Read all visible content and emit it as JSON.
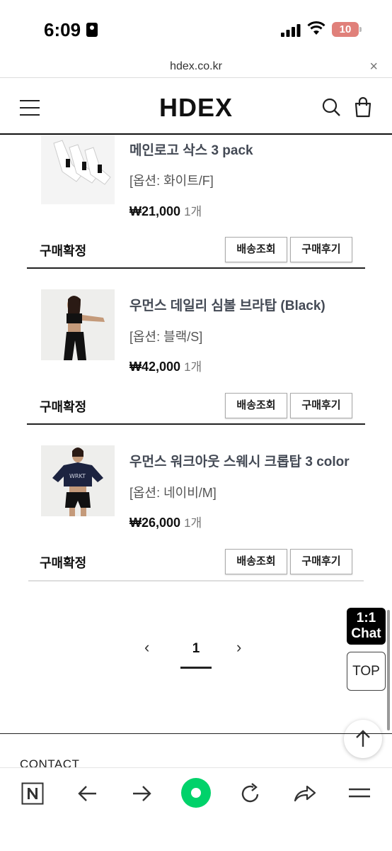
{
  "status_bar": {
    "time": "6:09",
    "battery": "10"
  },
  "url_bar": {
    "url": "hdex.co.kr",
    "close": "×"
  },
  "header": {
    "logo": "HDEX"
  },
  "orders": [
    {
      "name": "메인로고 삭스 3 pack",
      "option": "[옵션: 화이트/F]",
      "price": "₩21,000",
      "qty": "1개",
      "status": "구매확정",
      "track_label": "배송조회",
      "review_label": "구매후기",
      "thumb_icon": "white-socks-image"
    },
    {
      "name": "우먼스 데일리 심볼 브라탑 (Black)",
      "option": "[옵션: 블랙/S]",
      "price": "₩42,000",
      "qty": "1개",
      "status": "구매확정",
      "track_label": "배송조회",
      "review_label": "구매후기",
      "thumb_icon": "black-bra-top-model-image"
    },
    {
      "name": "우먼스 워크아웃 스웨시 크롭탑 3 color",
      "option": "[옵션: 네이비/M]",
      "price": "₩26,000",
      "qty": "1개",
      "status": "구매확정",
      "track_label": "배송조회",
      "review_label": "구매후기",
      "thumb_icon": "navy-crop-top-model-image"
    }
  ],
  "pagination": {
    "prev": "‹",
    "current": "1",
    "next": "›"
  },
  "floating": {
    "chat_line1": "1:1",
    "chat_line2": "Chat",
    "top": "TOP"
  },
  "footer": {
    "contact": "CONTACT"
  },
  "colors": {
    "accent_green": "#00d26a",
    "battery_red": "#e0807a"
  }
}
